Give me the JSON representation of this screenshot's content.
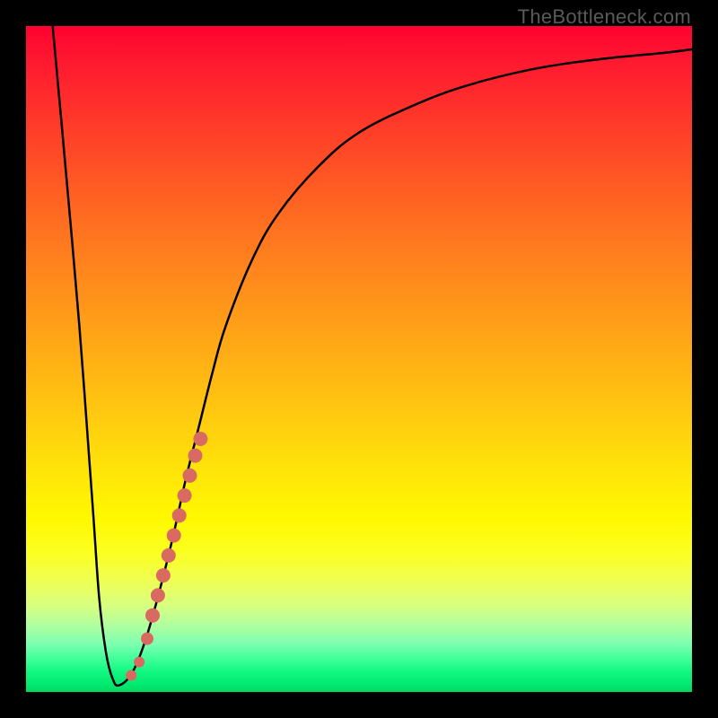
{
  "watermark": "TheBottleneck.com",
  "colors": {
    "frame": "#000000",
    "curve": "#000000",
    "marker": "#d86a62",
    "gradient_top": "#ff0030",
    "gradient_bottom": "#00d860"
  },
  "chart_data": {
    "type": "line",
    "title": "",
    "xlabel": "",
    "ylabel": "",
    "xlim": [
      0,
      100
    ],
    "ylim": [
      0,
      100
    ],
    "series": [
      {
        "name": "bottleneck-curve",
        "x": [
          4,
          6,
          8,
          10,
          11,
          12,
          13,
          14,
          16,
          18,
          20,
          22,
          24,
          26,
          28,
          30,
          34,
          38,
          44,
          50,
          58,
          66,
          76,
          86,
          96,
          100
        ],
        "y": [
          100,
          78,
          55,
          28,
          14,
          6,
          2,
          1,
          3,
          8,
          15,
          23,
          32,
          40,
          48,
          55,
          65,
          72,
          79,
          84,
          88,
          91,
          93.5,
          95,
          96,
          96.5
        ]
      }
    ],
    "markers": {
      "name": "highlighted-segment",
      "color": "#d86a62",
      "points": [
        {
          "x": 15.8,
          "y": 2.5,
          "r": 6
        },
        {
          "x": 17.0,
          "y": 4.5,
          "r": 6
        },
        {
          "x": 18.2,
          "y": 8.0,
          "r": 7
        },
        {
          "x": 19.0,
          "y": 11.5,
          "r": 8
        },
        {
          "x": 19.8,
          "y": 14.5,
          "r": 8
        },
        {
          "x": 20.6,
          "y": 17.5,
          "r": 8
        },
        {
          "x": 21.4,
          "y": 20.5,
          "r": 8
        },
        {
          "x": 22.2,
          "y": 23.5,
          "r": 8
        },
        {
          "x": 23.0,
          "y": 26.5,
          "r": 8
        },
        {
          "x": 23.8,
          "y": 29.5,
          "r": 8
        },
        {
          "x": 24.6,
          "y": 32.5,
          "r": 8
        },
        {
          "x": 25.4,
          "y": 35.5,
          "r": 8
        },
        {
          "x": 26.2,
          "y": 38.0,
          "r": 8
        }
      ]
    },
    "annotations": []
  }
}
